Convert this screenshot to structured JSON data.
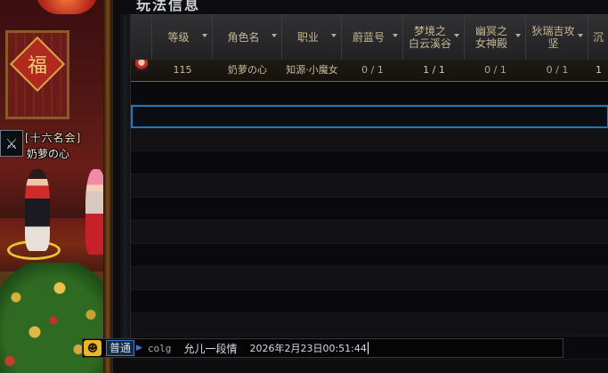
{
  "panel": {
    "title": "玩法信息"
  },
  "guild": {
    "name": "[十六名会]",
    "emblem_icon": "crossed-swords-icon"
  },
  "character": {
    "name": "奶萝の心"
  },
  "scene_decor": {
    "fu_char": "福"
  },
  "table": {
    "columns": [
      {
        "label": "",
        "sortable": false
      },
      {
        "label": "等级",
        "sortable": true
      },
      {
        "label": "角色名",
        "sortable": true
      },
      {
        "label": "职业",
        "sortable": true
      },
      {
        "label": "蔚蓝号",
        "sortable": true
      },
      {
        "label": "梦境之\n白云溪谷",
        "sortable": true
      },
      {
        "label": "幽冥之\n女神殿",
        "sortable": true
      },
      {
        "label": "狄瑞吉攻\n坚",
        "sortable": true
      },
      {
        "label": "沉",
        "sortable": false
      }
    ],
    "rows": [
      {
        "avatar_icon": "character-avatar-icon",
        "level": "115",
        "name": "奶萝の心",
        "job": "知源·小魔女",
        "azure": "0 / 1",
        "dream": "1 / 1",
        "nether": "0 / 1",
        "direzi": "0 / 1",
        "last": "1"
      }
    ]
  },
  "chat": {
    "face_icon": "emoji-face-icon",
    "channel": "普通",
    "user": "colg",
    "message": "允儿一段情",
    "timestamp": "2026年2月23日00:51:44"
  },
  "colors": {
    "selected_row_border": "#1f78b8",
    "header_text": "#c7b893",
    "channel_border": "#3a7ad0"
  }
}
